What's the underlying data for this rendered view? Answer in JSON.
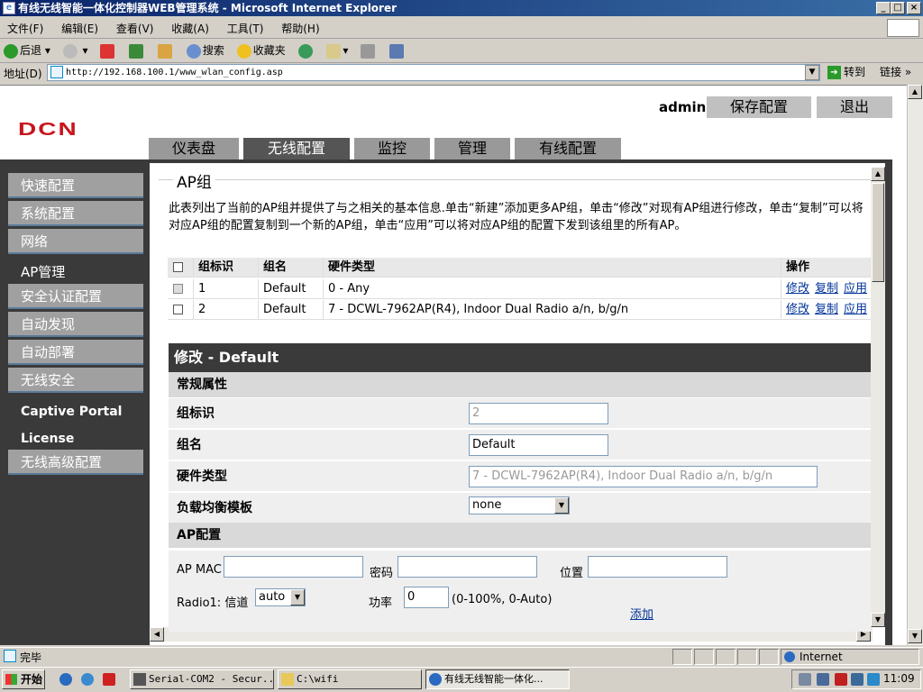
{
  "window": {
    "title": "有线无线智能一体化控制器WEB管理系统 - Microsoft Internet Explorer"
  },
  "menu": [
    "文件(F)",
    "编辑(E)",
    "查看(V)",
    "收藏(A)",
    "工具(T)",
    "帮助(H)"
  ],
  "toolbar": {
    "back": "后退",
    "search": "搜索",
    "favorites": "收藏夹"
  },
  "address": {
    "label": "地址(D)",
    "url": "http://192.168.100.1/www_wlan_config.asp",
    "go": "转到",
    "links": "链接"
  },
  "header": {
    "logo": "DCN",
    "user": "admin",
    "save_config": "保存配置",
    "logout": "退出",
    "tabs": [
      "仪表盘",
      "无线配置",
      "监控",
      "管理",
      "有线配置"
    ],
    "active_tab": "无线配置"
  },
  "sidebar": {
    "items": [
      "快速配置",
      "系统配置",
      "网络",
      "AP管理",
      "安全认证配置",
      "自动发现",
      "自动部署",
      "无线安全",
      "Captive Portal",
      "License",
      "无线高级配置"
    ]
  },
  "apgroup": {
    "title": "AP组",
    "description": "此表列出了当前的AP组并提供了与之相关的基本信息.单击“新建”添加更多AP组，单击“修改”对现有AP组进行修改，单击“复制”可以将对应AP组的配置复制到一个新的AP组，单击“应用”可以将对应AP组的配置下发到该组里的所有AP。",
    "columns": [
      "组标识",
      "组名",
      "硬件类型",
      "操作"
    ],
    "rows": [
      {
        "id": "1",
        "name": "Default",
        "hw": "0 - Any"
      },
      {
        "id": "2",
        "name": "Default",
        "hw": "7 - DCWL-7962AP(R4), Indoor Dual Radio a/n, b/g/n"
      }
    ],
    "actions": [
      "修改",
      "复制",
      "应用"
    ]
  },
  "edit": {
    "heading": "修改  - Default",
    "general_section": "常规属性",
    "group_id_label": "组标识",
    "group_id_value": "2",
    "group_name_label": "组名",
    "group_name_value": "Default",
    "hw_label": "硬件类型",
    "hw_value": "7 - DCWL-7962AP(R4), Indoor Dual Radio a/n, b/g/n",
    "lb_label": "负载均衡模板",
    "lb_value": "none",
    "ap_section": "AP配置",
    "ap_mac_label": "AP MAC",
    "password_label": "密码",
    "location_label": "位置",
    "radio1_label": "Radio1: 信道",
    "radio1_channel": "auto",
    "power_label": "功率",
    "power_value": "0",
    "power_hint": "(0-100%, 0-Auto)",
    "add": "添加"
  },
  "status": {
    "text": "完毕",
    "zone": "Internet"
  },
  "taskbar": {
    "start": "开始",
    "tasks": [
      "Serial-COM2 - Secur...",
      "C:\\wifi",
      "有线无线智能一体化..."
    ],
    "time": "11:09"
  }
}
